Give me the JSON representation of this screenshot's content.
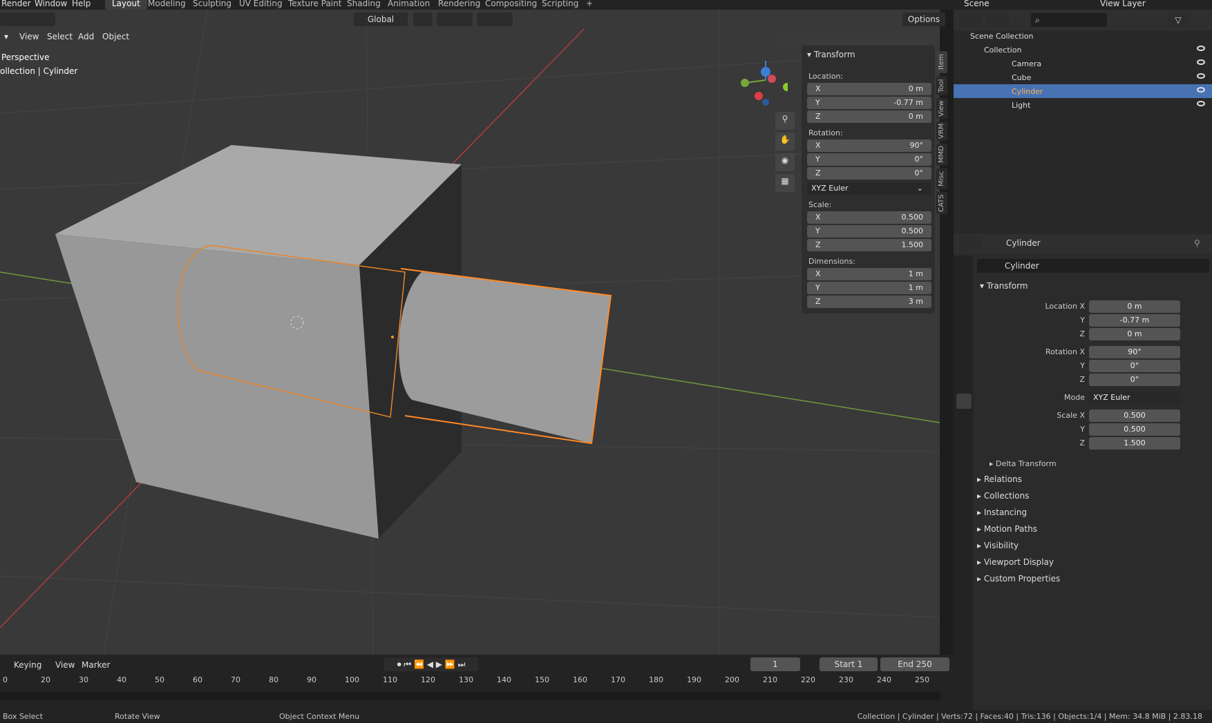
{
  "topbar": {
    "menus": [
      "Render",
      "Window",
      "Help"
    ],
    "workspaces": [
      "Layout",
      "Modeling",
      "Sculpting",
      "UV Editing",
      "Texture Paint",
      "Shading",
      "Animation",
      "Rendering",
      "Compositing",
      "Scripting",
      "+"
    ],
    "active_workspace": "Layout",
    "scene": "Scene",
    "view_layer": "View Layer"
  },
  "viewport": {
    "orientation": "Global",
    "options": "Options",
    "menu": [
      "View",
      "Select",
      "Add",
      "Object"
    ],
    "overlay_line1": "Perspective",
    "overlay_line2": "ollection | Cylinder"
  },
  "npanel": {
    "header": "Transform",
    "location_label": "Location:",
    "location": [
      {
        "axis": "X",
        "value": "0 m"
      },
      {
        "axis": "Y",
        "value": "-0.77 m"
      },
      {
        "axis": "Z",
        "value": "0 m"
      }
    ],
    "rotation_label": "Rotation:",
    "rotation": [
      {
        "axis": "X",
        "value": "90°"
      },
      {
        "axis": "Y",
        "value": "0°"
      },
      {
        "axis": "Z",
        "value": "0°"
      }
    ],
    "rotation_mode": "XYZ Euler",
    "scale_label": "Scale:",
    "scale": [
      {
        "axis": "X",
        "value": "0.500"
      },
      {
        "axis": "Y",
        "value": "0.500"
      },
      {
        "axis": "Z",
        "value": "1.500"
      }
    ],
    "dimensions_label": "Dimensions:",
    "dimensions": [
      {
        "axis": "X",
        "value": "1 m"
      },
      {
        "axis": "Y",
        "value": "1 m"
      },
      {
        "axis": "Z",
        "value": "3 m"
      }
    ],
    "tabs": [
      "Item",
      "Tool",
      "View",
      "VRM",
      "MMD",
      "Misc",
      "CATS"
    ]
  },
  "outliner": {
    "root": "Scene Collection",
    "collection": "Collection",
    "items": [
      "Camera",
      "Cube",
      "Cylinder",
      "Light"
    ],
    "selected": "Cylinder"
  },
  "properties": {
    "object_name": "Cylinder",
    "datablock": "Cylinder",
    "transform_header": "Transform",
    "location_x_label": "Location X",
    "y_label": "Y",
    "z_label": "Z",
    "location": [
      "0 m",
      "-0.77 m",
      "0 m"
    ],
    "rotation_x_label": "Rotation X",
    "rotation": [
      "90°",
      "0°",
      "0°"
    ],
    "mode_label": "Mode",
    "mode": "XYZ Euler",
    "scale_x_label": "Scale X",
    "scale": [
      "0.500",
      "0.500",
      "1.500"
    ],
    "delta": "Delta Transform",
    "sections": [
      "Relations",
      "Collections",
      "Instancing",
      "Motion Paths",
      "Visibility",
      "Viewport Display",
      "Custom Properties"
    ]
  },
  "timeline": {
    "menu": [
      "Keying",
      "View",
      "Marker"
    ],
    "current_frame": "1",
    "start_label": "Start",
    "start": "1",
    "end_label": "End",
    "end": "250",
    "ticks": [
      "0",
      "20",
      "30",
      "40",
      "50",
      "60",
      "70",
      "80",
      "90",
      "100",
      "110",
      "120",
      "130",
      "140",
      "150",
      "160",
      "170",
      "180",
      "190",
      "200",
      "210",
      "220",
      "230",
      "240",
      "250"
    ]
  },
  "statusbar": {
    "left1": "Box Select",
    "left2": "Rotate View",
    "left3": "Object Context Menu",
    "right": "Collection | Cylinder | Verts:72 | Faces:40 | Tris:136 | Objects:1/4 | Mem: 34.8 MiB | 2.83.18"
  },
  "colors": {
    "accent": "#4772b3",
    "selection": "#ff8a28",
    "viewport": "#393939"
  }
}
